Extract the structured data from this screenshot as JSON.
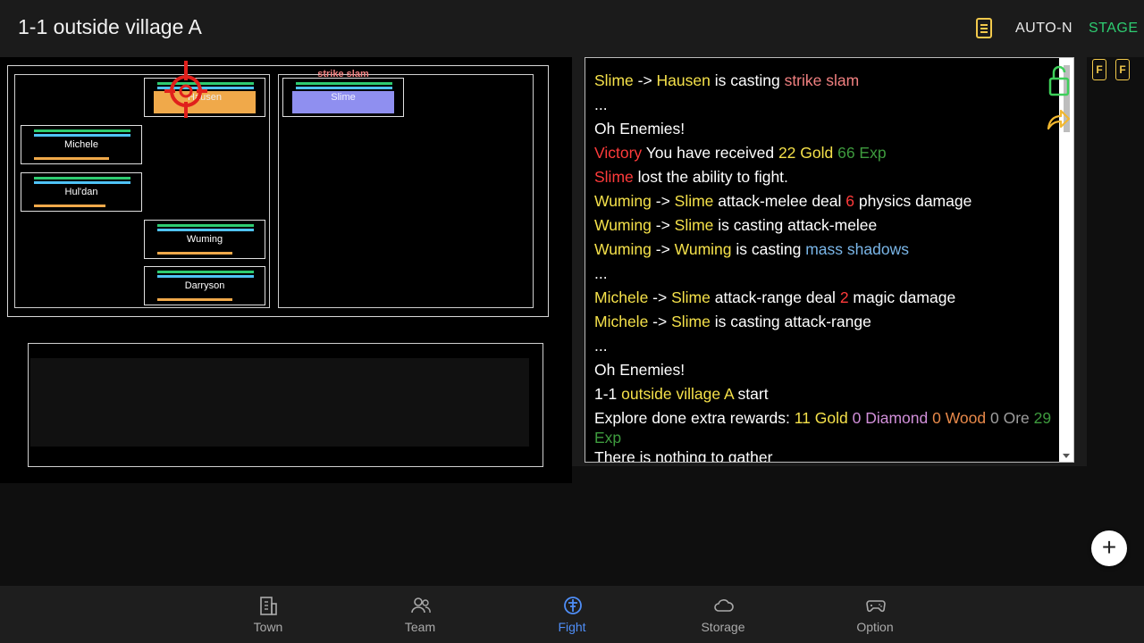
{
  "header": {
    "title": "1-1 outside village A",
    "auto_label": "AUTO-N",
    "stage_label": "STAGE",
    "accent_gold": "#f2c94c",
    "accent_green": "#2ecc71"
  },
  "battle": {
    "skill_label": "strike slam",
    "allies": [
      {
        "name": "Hausen",
        "stamina": 0.65
      },
      {
        "name": "Michele",
        "stamina": 0.78
      },
      {
        "name": "Hul'dan",
        "stamina": 0.74
      },
      {
        "name": "Wuming",
        "stamina": 0.78
      },
      {
        "name": "Darryson",
        "stamina": 0.78
      }
    ],
    "enemies": [
      {
        "name": "Slime"
      }
    ]
  },
  "log": [
    [
      {
        "t": "Slime",
        "c": "#f5e14a"
      },
      {
        "t": " -> ",
        "c": "#fff"
      },
      {
        "t": "Hausen",
        "c": "#f5e14a"
      },
      {
        "t": " is casting ",
        "c": "#fff"
      },
      {
        "t": "strike slam",
        "c": "#f08080"
      }
    ],
    [
      {
        "t": "...",
        "c": "#fff"
      }
    ],
    [
      {
        "t": "Oh Enemies!",
        "c": "#fff"
      }
    ],
    [
      {
        "t": "Victory",
        "c": "#ff3b3b"
      },
      {
        "t": " You have received ",
        "c": "#fff"
      },
      {
        "t": "22 Gold",
        "c": "#f5e14a"
      },
      {
        "t": " ",
        "c": "#fff"
      },
      {
        "t": "66 Exp",
        "c": "#3e9b3e"
      }
    ],
    [
      {
        "t": "Slime",
        "c": "#ff3b3b"
      },
      {
        "t": " lost the ability to fight.",
        "c": "#fff"
      }
    ],
    [
      {
        "t": "Wuming",
        "c": "#f5e14a"
      },
      {
        "t": " -> ",
        "c": "#fff"
      },
      {
        "t": "Slime",
        "c": "#f5e14a"
      },
      {
        "t": " attack-melee deal ",
        "c": "#fff"
      },
      {
        "t": "6",
        "c": "#ff3b3b"
      },
      {
        "t": " physics damage",
        "c": "#fff"
      }
    ],
    [
      {
        "t": "Wuming",
        "c": "#f5e14a"
      },
      {
        "t": " -> ",
        "c": "#fff"
      },
      {
        "t": "Slime",
        "c": "#f5e14a"
      },
      {
        "t": " is casting attack-melee",
        "c": "#fff"
      }
    ],
    [
      {
        "t": "Wuming",
        "c": "#f5e14a"
      },
      {
        "t": " -> ",
        "c": "#fff"
      },
      {
        "t": "Wuming",
        "c": "#f5e14a"
      },
      {
        "t": " is casting ",
        "c": "#fff"
      },
      {
        "t": "mass shadows",
        "c": "#7ab6e8"
      }
    ],
    [
      {
        "t": "...",
        "c": "#fff"
      }
    ],
    [
      {
        "t": "Michele",
        "c": "#f5e14a"
      },
      {
        "t": " -> ",
        "c": "#fff"
      },
      {
        "t": "Slime",
        "c": "#f5e14a"
      },
      {
        "t": " attack-range deal ",
        "c": "#fff"
      },
      {
        "t": "2",
        "c": "#ff3b3b"
      },
      {
        "t": " magic damage",
        "c": "#fff"
      }
    ],
    [
      {
        "t": "Michele",
        "c": "#f5e14a"
      },
      {
        "t": " -> ",
        "c": "#fff"
      },
      {
        "t": "Slime",
        "c": "#f5e14a"
      },
      {
        "t": " is casting attack-range",
        "c": "#fff"
      }
    ],
    [
      {
        "t": "...",
        "c": "#fff"
      }
    ],
    [
      {
        "t": "Oh Enemies!",
        "c": "#fff"
      }
    ],
    [
      {
        "t": "1-1 ",
        "c": "#fff"
      },
      {
        "t": "outside village A",
        "c": "#f5e14a"
      },
      {
        "t": " start",
        "c": "#fff"
      }
    ],
    [
      {
        "t": "Explore done extra rewards: ",
        "c": "#fff"
      },
      {
        "t": "11 Gold",
        "c": "#f5e14a"
      },
      {
        "t": " ",
        "c": "#fff"
      },
      {
        "t": "0 Diamond",
        "c": "#d18fd9"
      },
      {
        "t": " ",
        "c": "#fff"
      },
      {
        "t": "0 Wood",
        "c": "#e8894a"
      },
      {
        "t": " ",
        "c": "#fff"
      },
      {
        "t": "0 Ore",
        "c": "#9e9e9e"
      },
      {
        "t": " ",
        "c": "#fff"
      },
      {
        "t": "29",
        "c": "#3e9b3e"
      }
    ],
    [
      {
        "t": "Exp",
        "c": "#3e9b3e"
      }
    ],
    [
      {
        "t": "There is nothing to gather",
        "c": "#fff"
      }
    ]
  ],
  "side_buttons": [
    "F",
    "F"
  ],
  "fab_label": "+",
  "nav": [
    {
      "label": "Town",
      "icon": "building-icon",
      "active": false
    },
    {
      "label": "Team",
      "icon": "people-icon",
      "active": false
    },
    {
      "label": "Fight",
      "icon": "sword-icon",
      "active": true
    },
    {
      "label": "Storage",
      "icon": "cloud-icon",
      "active": false
    },
    {
      "label": "Option",
      "icon": "gamepad-icon",
      "active": false
    }
  ],
  "nav_active_color": "#4f8ef7"
}
